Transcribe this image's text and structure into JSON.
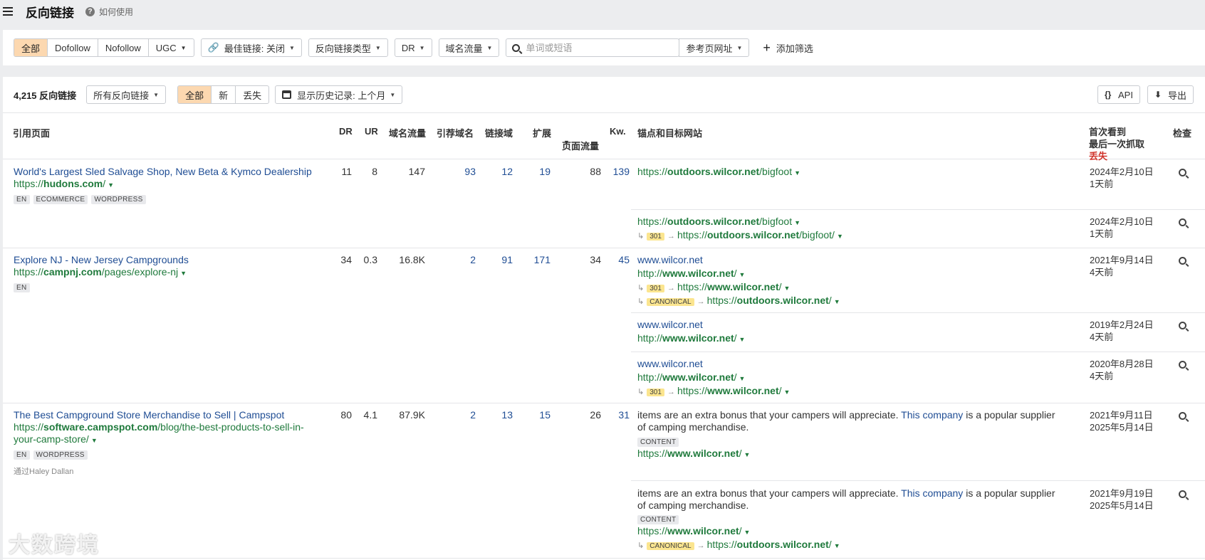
{
  "header": {
    "title": "反向链接",
    "help": "如何使用"
  },
  "filters": {
    "seg": [
      "全部",
      "Dofollow",
      "Nofollow",
      "UGC"
    ],
    "best_link": "最佳链接: 关闭",
    "link_type": "反向链接类型",
    "dr": "DR",
    "traffic": "域名流量",
    "search_placeholder": "单词或短语",
    "ref_url": "参考页网址",
    "add_filter": "添加筛选"
  },
  "toolbar": {
    "count": "4,215 反向链接",
    "all_links": "所有反向链接",
    "seg": [
      "全部",
      "新",
      "丢失"
    ],
    "history": "显示历史记录: 上个月",
    "api": "API",
    "export": "导出"
  },
  "columns": {
    "ref_page": "引用页面",
    "dr": "DR",
    "ur": "UR",
    "domain_traffic": "域名流量",
    "ref_domains": "引荐域名",
    "linked_domains": "链接域",
    "ext": "扩展",
    "page_traffic": "页面流量",
    "kw": "Kw.",
    "anchor": "锚点和目标网站",
    "first_seen": "首次看到",
    "last_crawl": "最后一次抓取",
    "lost": "丢失",
    "inspect": "检查"
  },
  "rows": [
    {
      "title": "World's Largest Sled Salvage Shop, New Beta & Kymco Dealership",
      "url_pre": "https://",
      "url_domain": "hudons.com",
      "url_path": "/",
      "tags": [
        "EN",
        "ECOMMERCE",
        "WORDPRESS"
      ],
      "dr": "11",
      "ur": "8",
      "domain_traffic": "147",
      "ref_domains": "93",
      "linked_domains": "12",
      "ext": "19",
      "page_traffic": "88",
      "kw": "139",
      "links": [
        {
          "t_pre": "https://",
          "t_dom": "outdoors.wilcor.net",
          "t_path": "/bigfoot",
          "first": "2024年2月10日",
          "last": "1天前"
        },
        {
          "t_pre": "https://",
          "t_dom": "outdoors.wilcor.net",
          "t_path": "/bigfoot",
          "r_code": "301",
          "r_pre": "https://",
          "r_dom": "outdoors.wilcor.net",
          "r_path": "/bigfoot/",
          "first": "2024年2月10日",
          "last": "1天前"
        }
      ]
    },
    {
      "title": "Explore NJ - New Jersey Campgrounds",
      "url_pre": "https://",
      "url_domain": "campnj.com",
      "url_path": "/pages/explore-nj",
      "tags": [
        "EN"
      ],
      "dr": "34",
      "ur": "0.3",
      "domain_traffic": "16.8K",
      "ref_domains": "2",
      "linked_domains": "91",
      "ext": "171",
      "page_traffic": "34",
      "kw": "45",
      "links": [
        {
          "anchor": "www.wilcor.net",
          "t_pre": "http://",
          "t_dom": "www.wilcor.net",
          "t_path": "/",
          "r_code": "301",
          "r_pre": "https://",
          "r_dom": "www.wilcor.net",
          "r_path": "/",
          "c_code": "CANONICAL",
          "c_pre": "https://",
          "c_dom": "outdoors.wilcor.net",
          "c_path": "/",
          "first": "2021年9月14日",
          "last": "4天前"
        },
        {
          "anchor": "www.wilcor.net",
          "t_pre": "http://",
          "t_dom": "www.wilcor.net",
          "t_path": "/",
          "first": "2019年2月24日",
          "last": "4天前"
        },
        {
          "anchor": "www.wilcor.net",
          "t_pre": "http://",
          "t_dom": "www.wilcor.net",
          "t_path": "/",
          "r_code": "301",
          "r_pre": "https://",
          "r_dom": "www.wilcor.net",
          "r_path": "/",
          "first": "2020年8月28日",
          "last": "4天前"
        }
      ]
    },
    {
      "title": "The Best Campground Store Merchandise to Sell | Campspot",
      "url_pre": "https://",
      "url_domain": "software.campspot.com",
      "url_path": "/blog/the-best-products-to-sell-in-",
      "url_path2": "your-camp-store/",
      "tags": [
        "EN",
        "WORDPRESS"
      ],
      "via": "通过Haley Dallan",
      "dr": "80",
      "ur": "4.1",
      "domain_traffic": "87.9K",
      "ref_domains": "2",
      "linked_domains": "13",
      "ext": "15",
      "page_traffic": "26",
      "kw": "31",
      "links": [
        {
          "text_a": "items are an extra bonus that your campers will appreciate. ",
          "text_link": "This company",
          "text_b": " is a popular supplier",
          "text_c": "of camping merchandise.",
          "tag": "CONTENT",
          "t_pre": "https://",
          "t_dom": "www.wilcor.net",
          "t_path": "/",
          "first": "2021年9月11日",
          "last": "2025年5月14日"
        },
        {
          "text_a": "items are an extra bonus that your campers will appreciate. ",
          "text_link": "This company",
          "text_b": " is a popular supplier",
          "text_c": "of camping merchandise.",
          "tag": "CONTENT",
          "t_pre": "https://",
          "t_dom": "www.wilcor.net",
          "t_path": "/",
          "c_code": "CANONICAL",
          "c_pre": "https://",
          "c_dom": "outdoors.wilcor.net",
          "c_path": "/",
          "first": "2021年9月19日",
          "last": "2025年5月14日"
        }
      ]
    }
  ],
  "watermark": "大数跨境"
}
